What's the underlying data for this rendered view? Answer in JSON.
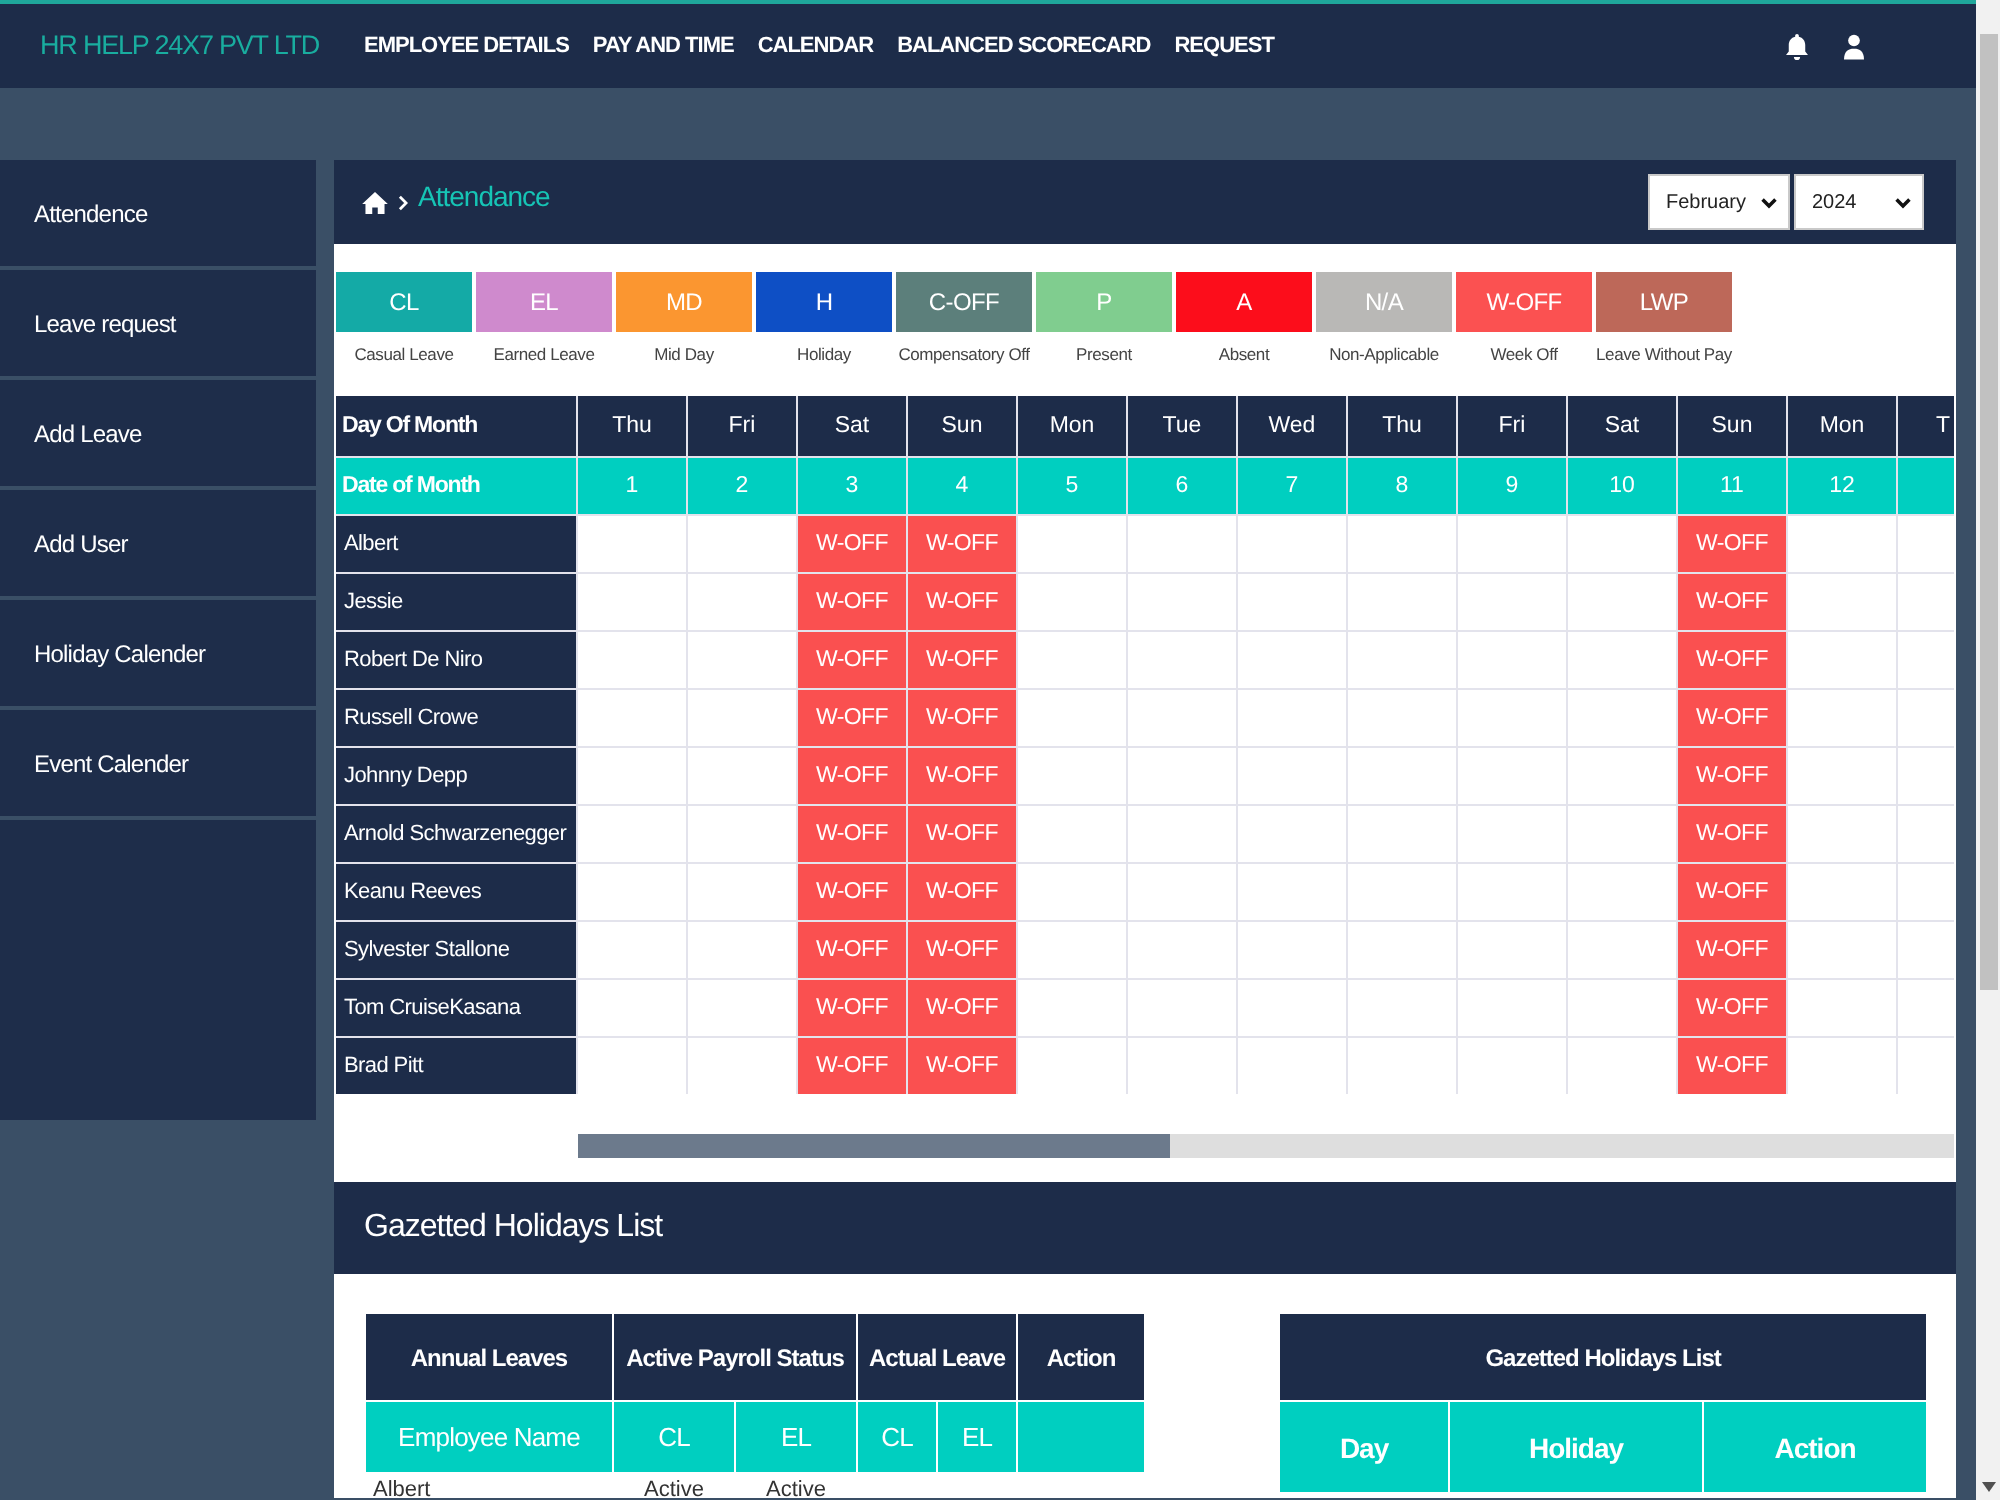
{
  "header": {
    "logo": "HR HELP 24X7 PVT LTD",
    "nav": [
      "EMPLOYEE DETAILS",
      "PAY AND TIME",
      "CALENDAR",
      "BALANCED SCORECARD",
      "REQUEST"
    ]
  },
  "sidebar": {
    "items": [
      "Attendence",
      "Leave request",
      "Add Leave",
      "Add User",
      "Holiday Calender",
      "Event Calender"
    ]
  },
  "attendance": {
    "title": "Attendance",
    "month": "February",
    "year": "2024",
    "legend": [
      {
        "code": "CL",
        "label": "Casual Leave",
        "color": "#14aaa6"
      },
      {
        "code": "EL",
        "label": "Earned Leave",
        "color": "#cf8acd"
      },
      {
        "code": "MD",
        "label": "Mid Day",
        "color": "#fb9630"
      },
      {
        "code": "H",
        "label": "Holiday",
        "color": "#0e4fc5"
      },
      {
        "code": "C-OFF",
        "label": "Compensatory Off",
        "color": "#5c7f7b"
      },
      {
        "code": "P",
        "label": "Present",
        "color": "#80cd8f"
      },
      {
        "code": "A",
        "label": "Absent",
        "color": "#fc0d1b"
      },
      {
        "code": "N/A",
        "label": "Non-Applicable",
        "color": "#b9b8b6"
      },
      {
        "code": "W-OFF",
        "label": "Week Off",
        "color": "#fb5151"
      },
      {
        "code": "LWP",
        "label": "Leave Without Pay",
        "color": "#bd6859"
      }
    ],
    "table": {
      "day_label": "Day Of Month",
      "date_label": "Date of Month",
      "columns": [
        {
          "day": "Thu",
          "date": "1"
        },
        {
          "day": "Fri",
          "date": "2"
        },
        {
          "day": "Sat",
          "date": "3"
        },
        {
          "day": "Sun",
          "date": "4"
        },
        {
          "day": "Mon",
          "date": "5"
        },
        {
          "day": "Tue",
          "date": "6"
        },
        {
          "day": "Wed",
          "date": "7"
        },
        {
          "day": "Thu",
          "date": "8"
        },
        {
          "day": "Fri",
          "date": "9"
        },
        {
          "day": "Sat",
          "date": "10"
        },
        {
          "day": "Sun",
          "date": "11"
        },
        {
          "day": "Mon",
          "date": "12"
        },
        {
          "day": "T"
        }
      ],
      "rows": [
        {
          "name": "Albert",
          "cells": [
            null,
            null,
            {
              "code": "W-OFF",
              "color": "#fa5050"
            },
            {
              "code": "W-OFF",
              "color": "#fa5050"
            },
            null,
            null,
            null,
            null,
            null,
            null,
            {
              "code": "W-OFF",
              "color": "#fa5050"
            },
            null,
            null
          ]
        },
        {
          "name": "Jessie",
          "cells": [
            null,
            null,
            {
              "code": "W-OFF",
              "color": "#fa5050"
            },
            {
              "code": "W-OFF",
              "color": "#fa5050"
            },
            null,
            null,
            null,
            null,
            null,
            null,
            {
              "code": "W-OFF",
              "color": "#fa5050"
            },
            null,
            null
          ]
        },
        {
          "name": "Robert De Niro",
          "cells": [
            null,
            null,
            {
              "code": "W-OFF",
              "color": "#fa5050"
            },
            {
              "code": "W-OFF",
              "color": "#fa5050"
            },
            null,
            null,
            null,
            null,
            null,
            null,
            {
              "code": "W-OFF",
              "color": "#fa5050"
            },
            null,
            null
          ]
        },
        {
          "name": "Russell Crowe",
          "cells": [
            null,
            null,
            {
              "code": "W-OFF",
              "color": "#fa5050"
            },
            {
              "code": "W-OFF",
              "color": "#fa5050"
            },
            null,
            null,
            null,
            null,
            null,
            null,
            {
              "code": "W-OFF",
              "color": "#fa5050"
            },
            null,
            null
          ]
        },
        {
          "name": "Johnny Depp",
          "cells": [
            null,
            null,
            {
              "code": "W-OFF",
              "color": "#fa5050"
            },
            {
              "code": "W-OFF",
              "color": "#fa5050"
            },
            null,
            null,
            null,
            null,
            null,
            null,
            {
              "code": "W-OFF",
              "color": "#fa5050"
            },
            null,
            null
          ]
        },
        {
          "name": "Arnold Schwarzenegger",
          "cells": [
            null,
            null,
            {
              "code": "W-OFF",
              "color": "#fa5050"
            },
            {
              "code": "W-OFF",
              "color": "#fa5050"
            },
            null,
            null,
            null,
            null,
            null,
            null,
            {
              "code": "W-OFF",
              "color": "#fa5050"
            },
            null,
            null
          ]
        },
        {
          "name": "Keanu Reeves",
          "cells": [
            null,
            null,
            {
              "code": "W-OFF",
              "color": "#fa5050"
            },
            {
              "code": "W-OFF",
              "color": "#fa5050"
            },
            null,
            null,
            null,
            null,
            null,
            null,
            {
              "code": "W-OFF",
              "color": "#fa5050"
            },
            null,
            null
          ]
        },
        {
          "name": "Sylvester Stallone",
          "cells": [
            null,
            null,
            {
              "code": "W-OFF",
              "color": "#fa5050"
            },
            {
              "code": "W-OFF",
              "color": "#fa5050"
            },
            null,
            null,
            null,
            null,
            null,
            null,
            {
              "code": "W-OFF",
              "color": "#fa5050"
            },
            null,
            null
          ]
        },
        {
          "name": "Tom CruiseKasana",
          "cells": [
            null,
            null,
            {
              "code": "W-OFF",
              "color": "#fa5050"
            },
            {
              "code": "W-OFF",
              "color": "#fa5050"
            },
            null,
            null,
            null,
            null,
            null,
            null,
            {
              "code": "W-OFF",
              "color": "#fa5050"
            },
            null,
            null
          ]
        },
        {
          "name": "Brad Pitt",
          "cells": [
            null,
            null,
            {
              "code": "W-OFF",
              "color": "#fa5050"
            },
            {
              "code": "W-OFF",
              "color": "#fa5050"
            },
            null,
            null,
            null,
            null,
            null,
            null,
            {
              "code": "W-OFF",
              "color": "#fa5050"
            },
            null,
            null
          ]
        }
      ]
    }
  },
  "gazetted": {
    "title": "Gazetted Holidays List",
    "leave_table": {
      "groups": [
        {
          "label": "Annual Leaves",
          "columns": [
            "Employee Name"
          ]
        },
        {
          "label": "Active Payroll Status",
          "columns": [
            "CL",
            "EL"
          ]
        },
        {
          "label": "Actual Leave",
          "columns": [
            "CL",
            "EL"
          ]
        },
        {
          "label": "Action"
        }
      ],
      "rows": [
        {
          "cells": [
            "Albert",
            "Active",
            "Active"
          ]
        }
      ]
    },
    "holiday_table": {
      "title": "Gazetted Holidays List",
      "columns": [
        "Day",
        "Holiday",
        "Action"
      ]
    }
  }
}
